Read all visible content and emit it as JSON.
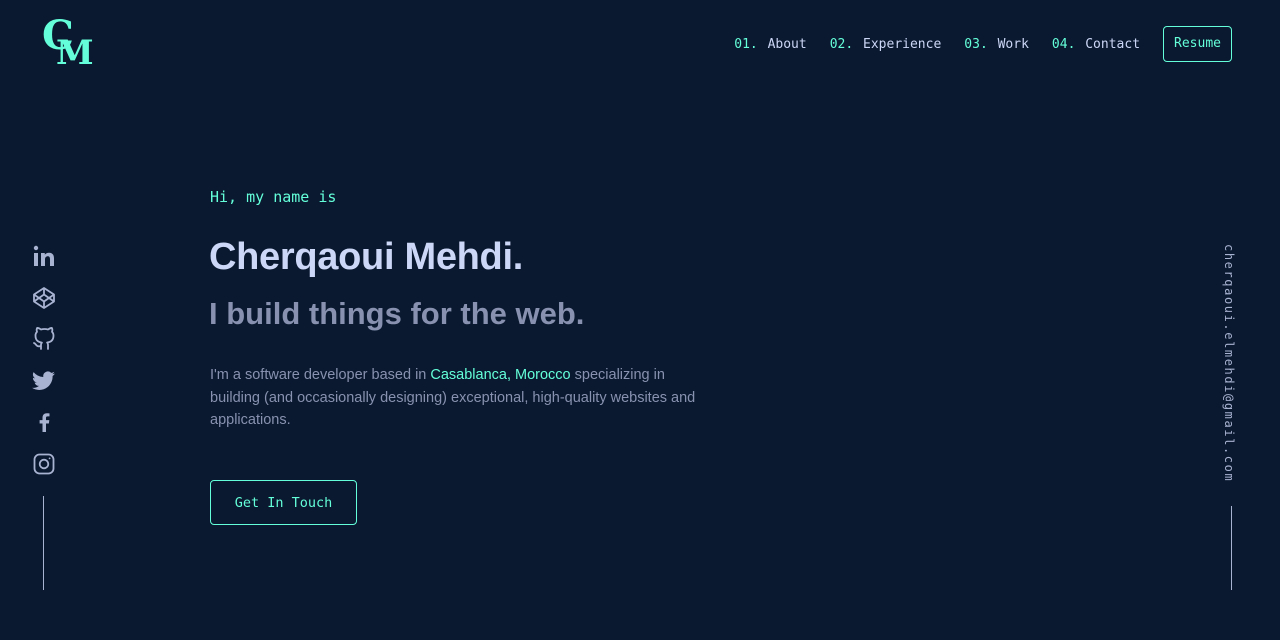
{
  "logo": {
    "letter_c": "C",
    "letter_m": "M"
  },
  "nav": {
    "items": [
      {
        "num": "01.",
        "label": "About"
      },
      {
        "num": "02.",
        "label": "Experience"
      },
      {
        "num": "03.",
        "label": "Work"
      },
      {
        "num": "04.",
        "label": "Contact"
      }
    ],
    "resume_label": "Resume"
  },
  "social": [
    "linkedin-icon",
    "codepen-icon",
    "github-icon",
    "twitter-icon",
    "facebook-icon",
    "instagram-icon"
  ],
  "email": "cherqaoui.elmehdi@gmail.com",
  "hero": {
    "greeting": "Hi, my name is",
    "name": "Cherqaoui Mehdi.",
    "tagline": "I build things for the web.",
    "bio_before": "I'm a software developer based in ",
    "bio_highlight": "Casablanca, Morocco",
    "bio_after": " specializing in building (and occasionally designing) exceptional, high-quality websites and applications.",
    "cta_label": "Get In Touch"
  },
  "colors": {
    "background": "#0a192f",
    "accent": "#64ffda",
    "heading": "#ccd6f6",
    "muted": "#8892b0"
  }
}
